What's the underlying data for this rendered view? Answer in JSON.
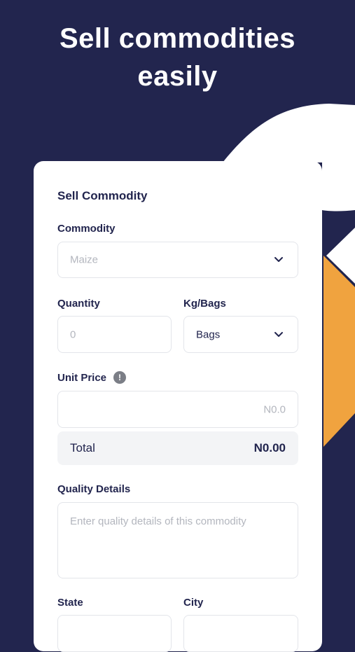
{
  "headline": {
    "line1": "Sell commodities",
    "line2": "easily"
  },
  "form": {
    "title": "Sell Commodity",
    "commodity": {
      "label": "Commodity",
      "placeholder": "Maize"
    },
    "quantity": {
      "label": "Quantity",
      "placeholder": "0"
    },
    "unit": {
      "label": "Kg/Bags",
      "value": "Bags"
    },
    "unit_price": {
      "label": "Unit Price",
      "placeholder": "N0.0",
      "info_icon": "!"
    },
    "total": {
      "label": "Total",
      "value": "N0.00"
    },
    "quality": {
      "label": "Quality Details",
      "placeholder": "Enter quality details of this commodity"
    },
    "state": {
      "label": "State"
    },
    "city": {
      "label": "City"
    }
  },
  "colors": {
    "background": "#22254e",
    "accent": "#f0a33f",
    "card": "#ffffff"
  }
}
